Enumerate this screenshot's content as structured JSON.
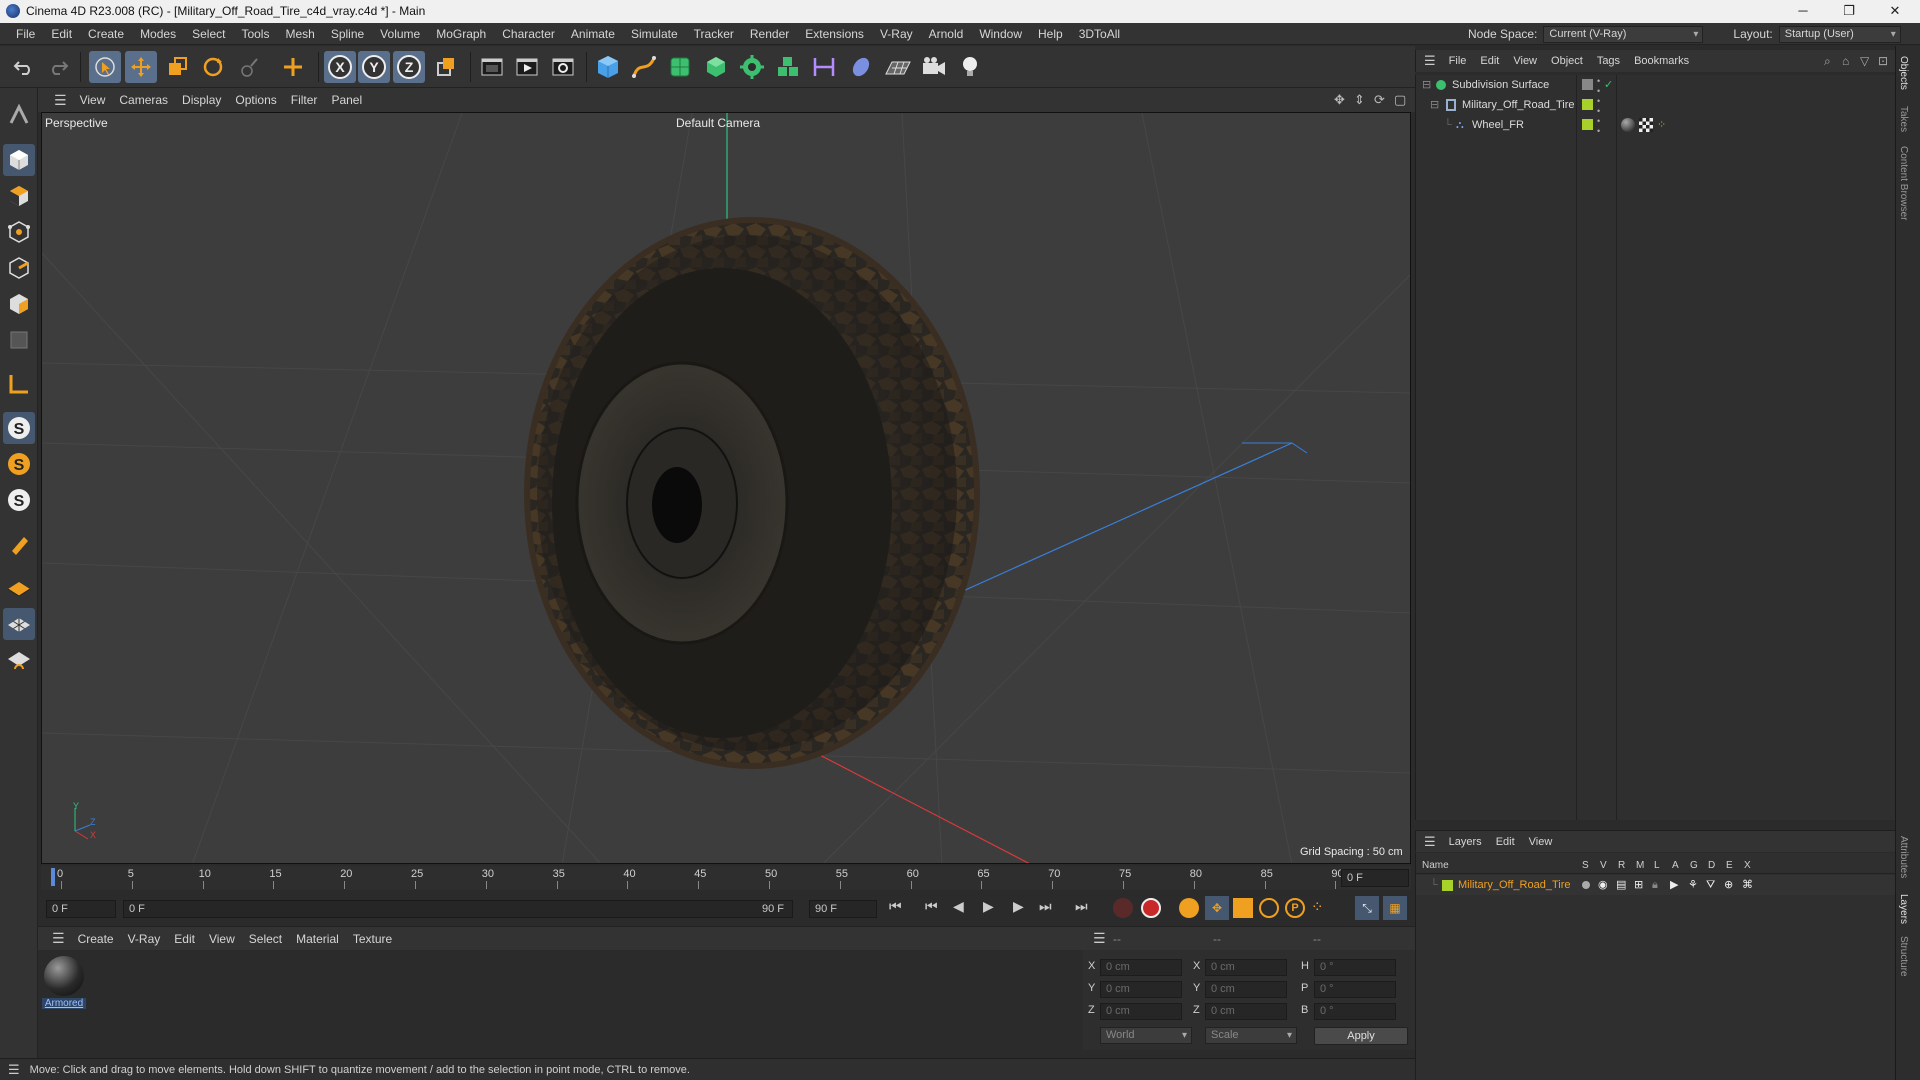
{
  "window": {
    "title": "Cinema 4D R23.008 (RC) - [Military_Off_Road_Tire_c4d_vray.c4d *] - Main",
    "controls": [
      "minimize",
      "maximize",
      "close"
    ]
  },
  "menubar": {
    "items": [
      "File",
      "Edit",
      "Create",
      "Modes",
      "Select",
      "Tools",
      "Mesh",
      "Spline",
      "Volume",
      "MoGraph",
      "Character",
      "Animate",
      "Simulate",
      "Tracker",
      "Render",
      "Extensions",
      "V-Ray",
      "Arnold",
      "Window",
      "Help",
      "3DToAll"
    ],
    "node_space_label": "Node Space:",
    "node_space_value": "Current (V-Ray)",
    "layout_label": "Layout:",
    "layout_value": "Startup (User)"
  },
  "viewport": {
    "menu": [
      "View",
      "Cameras",
      "Display",
      "Options",
      "Filter",
      "Panel"
    ],
    "view_name": "Perspective",
    "camera_name": "Default Camera",
    "grid_spacing": "Grid Spacing : 50 cm",
    "axis_y": "Y",
    "axis_z": "Z",
    "axis_x": "X"
  },
  "timeline": {
    "ticks": [
      "0",
      "5",
      "10",
      "15",
      "20",
      "25",
      "30",
      "35",
      "40",
      "45",
      "50",
      "55",
      "60",
      "65",
      "70",
      "75",
      "80",
      "85",
      "90"
    ],
    "current_frame_field": "0 F",
    "start_field": "0 F",
    "range_start": "0 F",
    "range_end": "90 F",
    "end_field": "90 F"
  },
  "material_manager": {
    "menu": [
      "Create",
      "V-Ray",
      "Edit",
      "View",
      "Select",
      "Material",
      "Texture"
    ],
    "materials": [
      {
        "name": "Armored"
      }
    ]
  },
  "coordinates": {
    "header": [
      "--",
      "--",
      "--"
    ],
    "position": [
      {
        "label": "X",
        "value": "0 cm"
      },
      {
        "label": "Y",
        "value": "0 cm"
      },
      {
        "label": "Z",
        "value": "0 cm"
      }
    ],
    "size": [
      {
        "label": "X",
        "value": "0 cm"
      },
      {
        "label": "Y",
        "value": "0 cm"
      },
      {
        "label": "Z",
        "value": "0 cm"
      }
    ],
    "rotation": [
      {
        "label": "H",
        "value": "0 °"
      },
      {
        "label": "P",
        "value": "0 °"
      },
      {
        "label": "B",
        "value": "0 °"
      }
    ],
    "mode_world": "World",
    "mode_scale": "Scale",
    "apply": "Apply"
  },
  "status": {
    "text": "Move: Click and drag to move elements. Hold down SHIFT to quantize movement / add to the selection in point mode, CTRL to remove."
  },
  "object_manager": {
    "menu": [
      "File",
      "Edit",
      "View",
      "Object",
      "Tags",
      "Bookmarks"
    ],
    "objects": [
      {
        "name": "Subdivision Surface"
      },
      {
        "name": "Military_Off_Road_Tire"
      },
      {
        "name": "Wheel_FR"
      }
    ]
  },
  "layer_manager": {
    "menu": [
      "Layers",
      "Edit",
      "View"
    ],
    "columns": [
      "Name",
      "S",
      "V",
      "R",
      "M",
      "L",
      "A",
      "G",
      "D",
      "E",
      "X"
    ],
    "layers": [
      {
        "name": "Military_Off_Road_Tire",
        "color": "#a8d12a"
      }
    ]
  },
  "side_tabs": [
    "Objects",
    "Takes",
    "Content Browser",
    "Attributes",
    "Layers",
    "Structure"
  ],
  "colors": {
    "accent": "#5a6f8c",
    "layer_orange": "#f0a020",
    "layer_green": "#a8d12a"
  }
}
